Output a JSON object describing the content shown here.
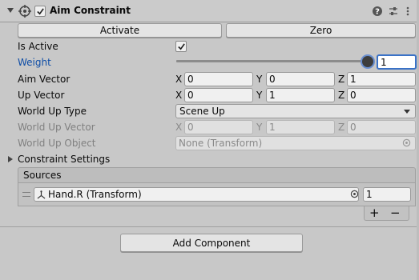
{
  "component": {
    "title": "Aim Constraint",
    "enabled": true
  },
  "buttons": {
    "activate": "Activate",
    "zero": "Zero",
    "add_component": "Add Component"
  },
  "properties": {
    "is_active": {
      "label": "Is Active",
      "checked": true
    },
    "weight": {
      "label": "Weight",
      "value": "1",
      "slider_fraction": 1.0
    },
    "aim_vector": {
      "label": "Aim Vector",
      "x": "0",
      "y": "0",
      "z": "1"
    },
    "up_vector": {
      "label": "Up Vector",
      "x": "0",
      "y": "1",
      "z": "0"
    },
    "world_up_type": {
      "label": "World Up Type",
      "value": "Scene Up"
    },
    "world_up_vector": {
      "label": "World Up Vector",
      "x": "0",
      "y": "1",
      "z": "0"
    },
    "world_up_object": {
      "label": "World Up Object",
      "value": "None (Transform)"
    }
  },
  "axis_labels": {
    "x": "X",
    "y": "Y",
    "z": "Z"
  },
  "constraint_settings": {
    "label": "Constraint Settings",
    "expanded": false
  },
  "sources": {
    "header": "Sources",
    "items": [
      {
        "object": "Hand.R (Transform)",
        "weight": "1"
      }
    ]
  },
  "list_controls": {
    "add": "+",
    "remove": "−"
  },
  "colors": {
    "background": "#c8c8c8",
    "weight_label_blue": "#0e4da6",
    "slider_focus": "#6a8fd0"
  }
}
